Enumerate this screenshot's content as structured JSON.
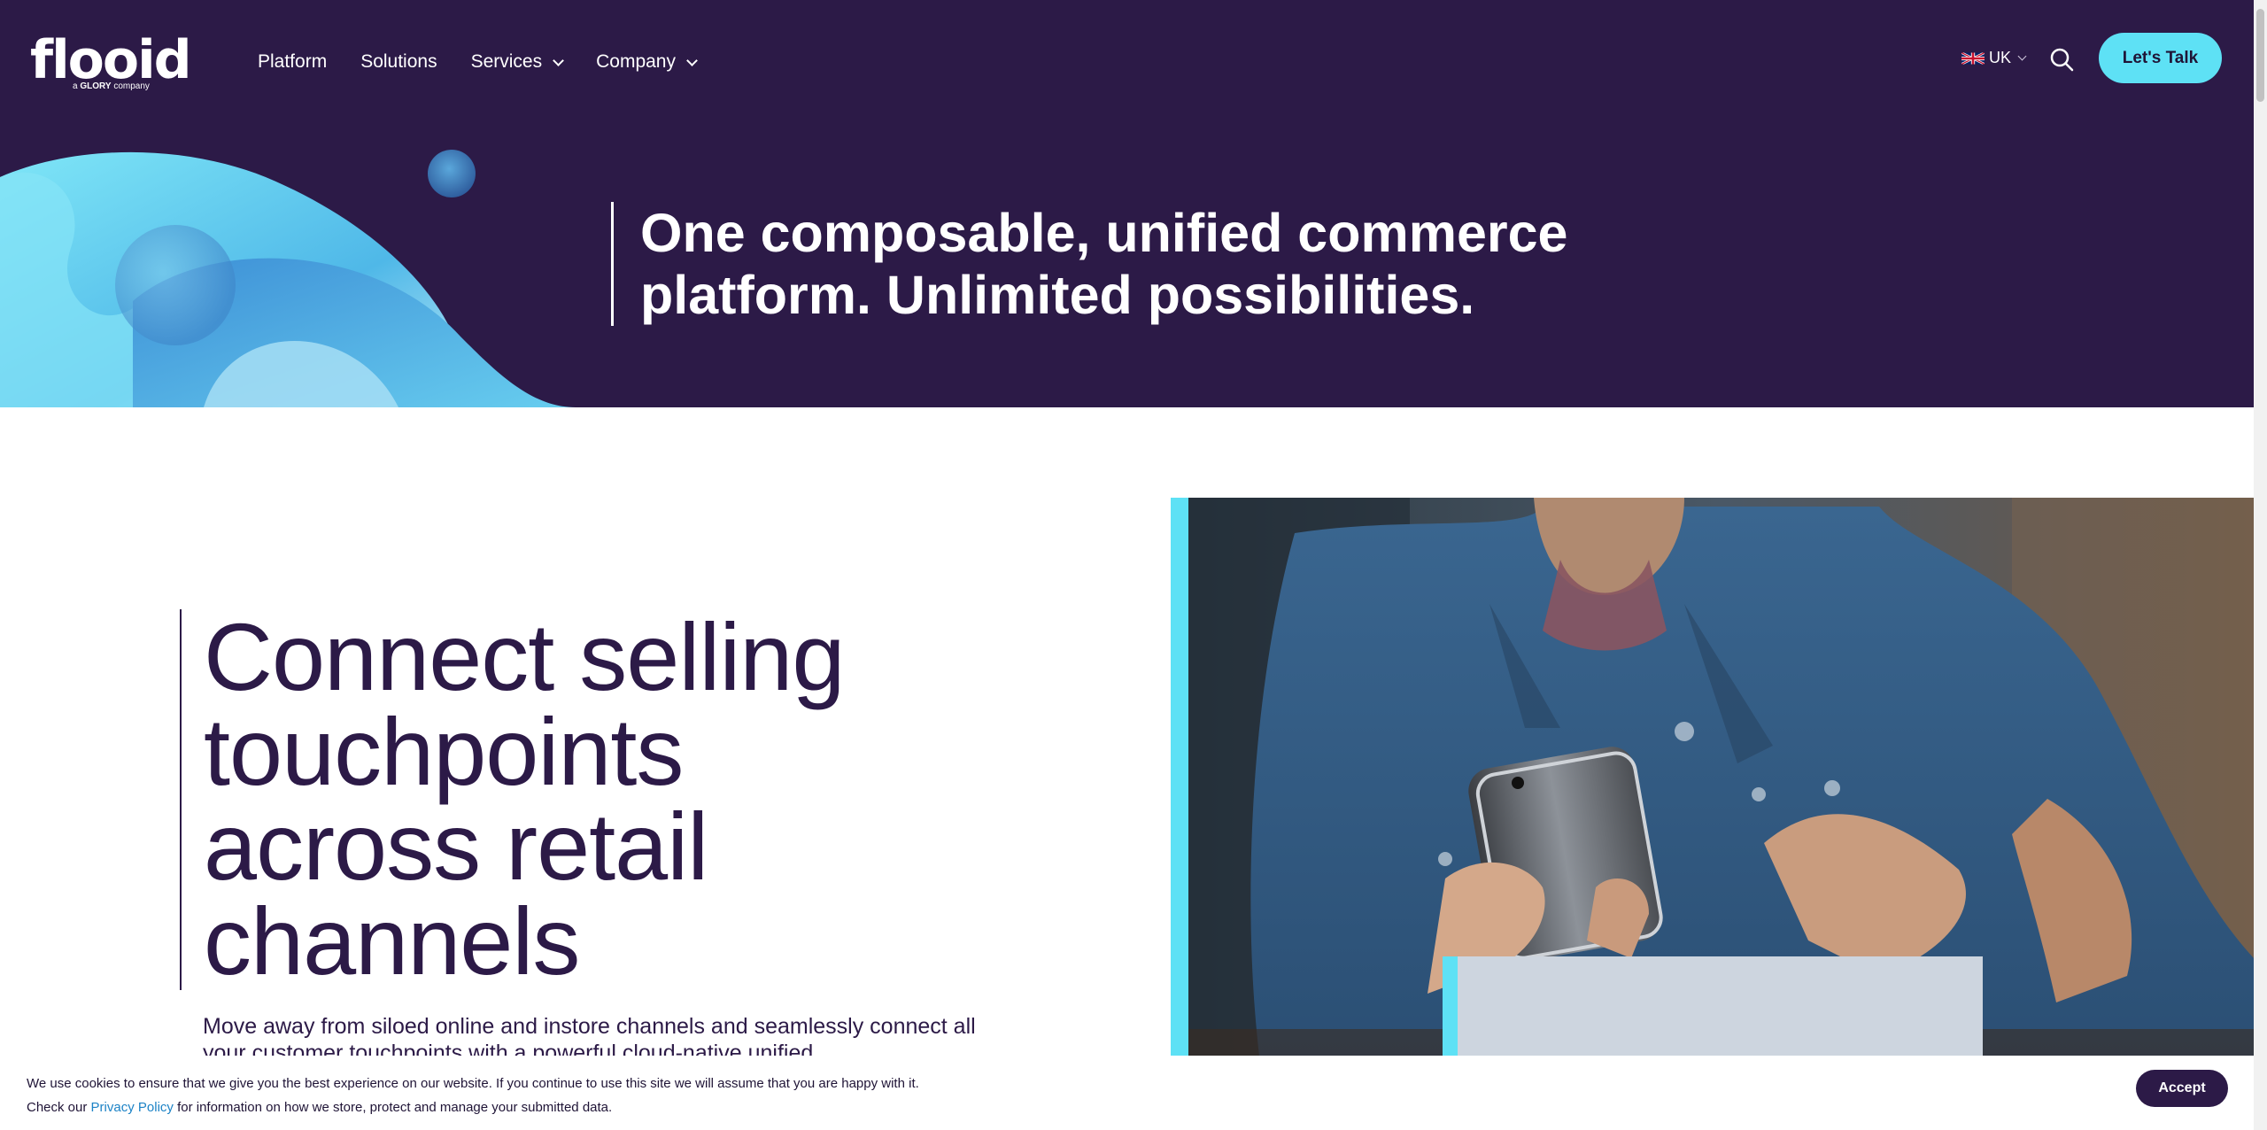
{
  "brand": {
    "name": "flooid",
    "tagline_prefix": "a",
    "tagline_brand": "GLORY",
    "tagline_suffix": "company"
  },
  "nav": {
    "items": [
      {
        "label": "Platform",
        "has_dropdown": false
      },
      {
        "label": "Solutions",
        "has_dropdown": false
      },
      {
        "label": "Services",
        "has_dropdown": true
      },
      {
        "label": "Company",
        "has_dropdown": true
      }
    ]
  },
  "header": {
    "locale": "UK",
    "cta_label": "Let's Talk"
  },
  "hero": {
    "title": "One composable, unified commerce platform. Unlimited possibilities."
  },
  "main": {
    "title": "Connect selling touchpoints across retail channels",
    "description": "Move away from siloed online and instore channels and seamlessly connect all your customer touchpoints with a powerful cloud-native unified"
  },
  "cookie": {
    "line1": "We use cookies to ensure that we give you the best experience on our website. If you continue to use this site we will assume that you are happy with it.",
    "line2_prefix": "Check our",
    "link_label": "Privacy Policy",
    "line2_suffix": "for information on how we store, protect and manage your submitted data.",
    "accept_label": "Accept"
  },
  "colors": {
    "hero_bg": "#2c1a47",
    "accent": "#5ee1f5",
    "text_dark": "#2c1a47",
    "link": "#1d83c6"
  }
}
